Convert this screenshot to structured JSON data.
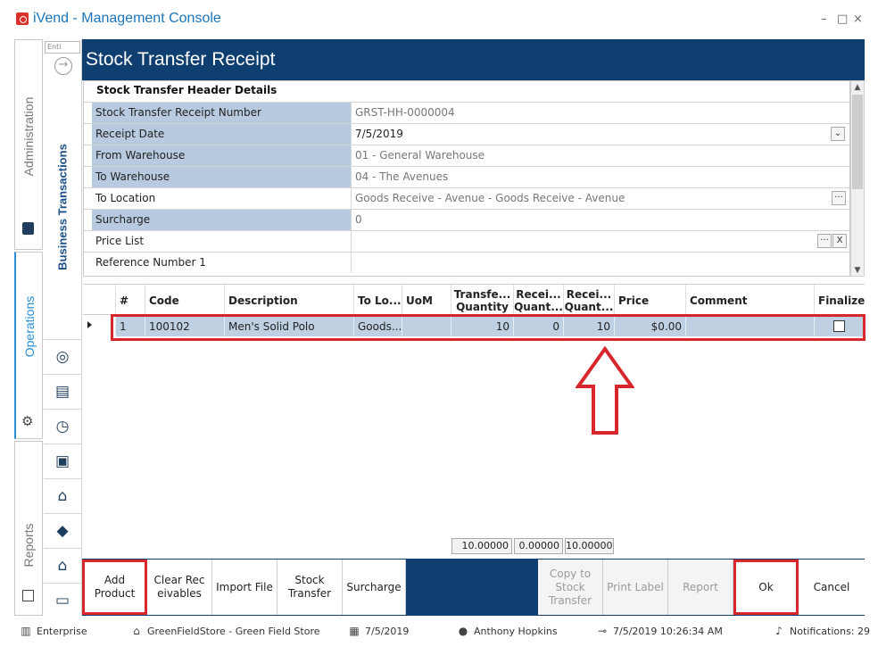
{
  "window": {
    "title": "iVend - Management Console",
    "controls": {
      "minimize": "–",
      "maximize": "□",
      "close": "×"
    }
  },
  "sidebar": {
    "tabs": [
      {
        "label": "Administration",
        "icon": "administration-icon"
      },
      {
        "label": "Operations",
        "icon": "gear-icon"
      },
      {
        "label": "Reports",
        "icon": "reports-icon"
      }
    ],
    "search_placeholder": "Enti",
    "section_label": "Business Transactions",
    "nav_icons": [
      "money-bag-icon",
      "cash-register-icon",
      "clock-icon",
      "gift-icon",
      "warehouse-icon",
      "tag-icon",
      "warehouse-stock-icon",
      "gift-card-icon"
    ]
  },
  "page": {
    "title": "Stock Transfer Receipt"
  },
  "header_details": {
    "section_title": "Stock Transfer Header Details",
    "rows": [
      {
        "label": "Stock Transfer Receipt Number",
        "value": "GRST-HH-0000004"
      },
      {
        "label": "Receipt Date",
        "value": "7/5/2019"
      },
      {
        "label": "From Warehouse",
        "value": "01 - General Warehouse"
      },
      {
        "label": "To Warehouse",
        "value": "04 - The Avenues"
      },
      {
        "label": "To Location",
        "value": "Goods Receive - Avenue - Goods Receive - Avenue"
      },
      {
        "label": "Surcharge",
        "value": "0"
      },
      {
        "label": "Price List",
        "value": ""
      },
      {
        "label": "Reference Number 1",
        "value": ""
      }
    ],
    "ellipsis": "···",
    "clear": "X"
  },
  "lines": {
    "columns": [
      "#",
      "Code",
      "Description",
      "To Lo...",
      "UoM",
      "Transfe... Quantity",
      "Recei... Quant...",
      "Recei... Quant...",
      "Price",
      "Comment",
      "Finalize"
    ],
    "rows": [
      {
        "num": "1",
        "code": "100102",
        "description": "Men's Solid Polo",
        "to_location": "Goods...",
        "uom": "",
        "transfer_qty": "10",
        "received_qty": "0",
        "receive_qty": "10",
        "price": "$0.00",
        "comment": "",
        "finalize": false
      }
    ],
    "totals": [
      "10.00000",
      "0.00000",
      "10.00000"
    ]
  },
  "toolbar": {
    "add_product": "Add Product",
    "clear_receivables": "Clear Receivables",
    "import_file": "Import File",
    "stock_transfer": "Stock Transfer",
    "surcharge": "Surcharge",
    "copy_to_stock_transfer": "Copy to Stock Transfer",
    "print_label": "Print Label",
    "report": "Report",
    "ok": "Ok",
    "cancel": "Cancel"
  },
  "statusbar": {
    "edition": "Enterprise",
    "store": "GreenFieldStore - Green Field Store",
    "date": "7/5/2019",
    "user": "Anthony Hopkins",
    "datetime": "7/5/2019 10:26:34 AM",
    "notifications": "Notifications: 29"
  },
  "colors": {
    "accent_blue": "#0f3f70",
    "highlight_red": "#d8262d",
    "row_selected": "#bfd0e2",
    "label_shade": "#b8cadf"
  }
}
